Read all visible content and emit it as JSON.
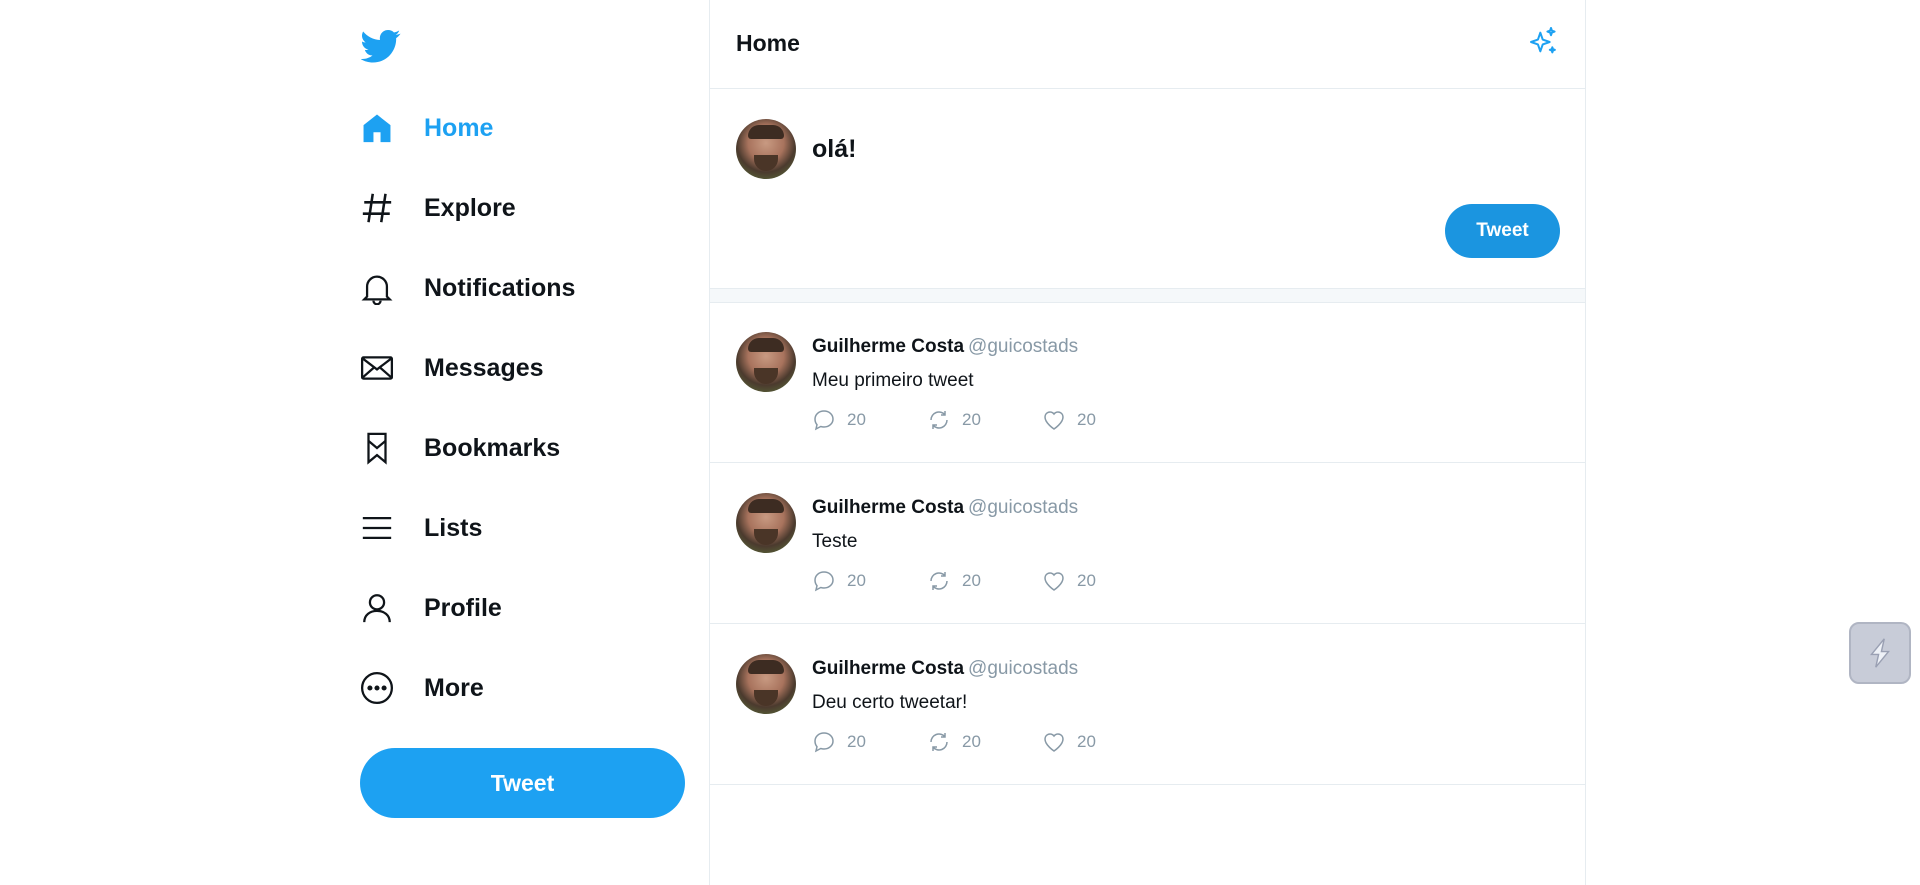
{
  "sidebar": {
    "logo_icon": "twitter-bird-icon",
    "items": [
      {
        "label": "Home",
        "icon": "home-icon",
        "active": true
      },
      {
        "label": "Explore",
        "icon": "hashtag-icon",
        "active": false
      },
      {
        "label": "Notifications",
        "icon": "bell-icon",
        "active": false
      },
      {
        "label": "Messages",
        "icon": "envelope-icon",
        "active": false
      },
      {
        "label": "Bookmarks",
        "icon": "bookmark-icon",
        "active": false
      },
      {
        "label": "Lists",
        "icon": "list-icon",
        "active": false
      },
      {
        "label": "Profile",
        "icon": "user-icon",
        "active": false
      },
      {
        "label": "More",
        "icon": "more-circle-icon",
        "active": false
      }
    ],
    "tweet_button": "Tweet"
  },
  "header": {
    "title": "Home",
    "icon": "sparkle-icon"
  },
  "composer": {
    "value": "olá!",
    "tweet_button": "Tweet"
  },
  "tweets": [
    {
      "name": "Guilherme Costa",
      "handle": "@guicostads",
      "text": "Meu primeiro tweet",
      "replies": "20",
      "retweets": "20",
      "likes": "20"
    },
    {
      "name": "Guilherme Costa",
      "handle": "@guicostads",
      "text": "Teste",
      "replies": "20",
      "retweets": "20",
      "likes": "20"
    },
    {
      "name": "Guilherme Costa",
      "handle": "@guicostads",
      "text": "Deu certo tweetar!",
      "replies": "20",
      "retweets": "20",
      "likes": "20"
    }
  ],
  "colors": {
    "accent": "#1da1f2",
    "tweet_button_dark": "#1b95e0",
    "muted": "#8899a6",
    "border": "#e6ecf0"
  }
}
